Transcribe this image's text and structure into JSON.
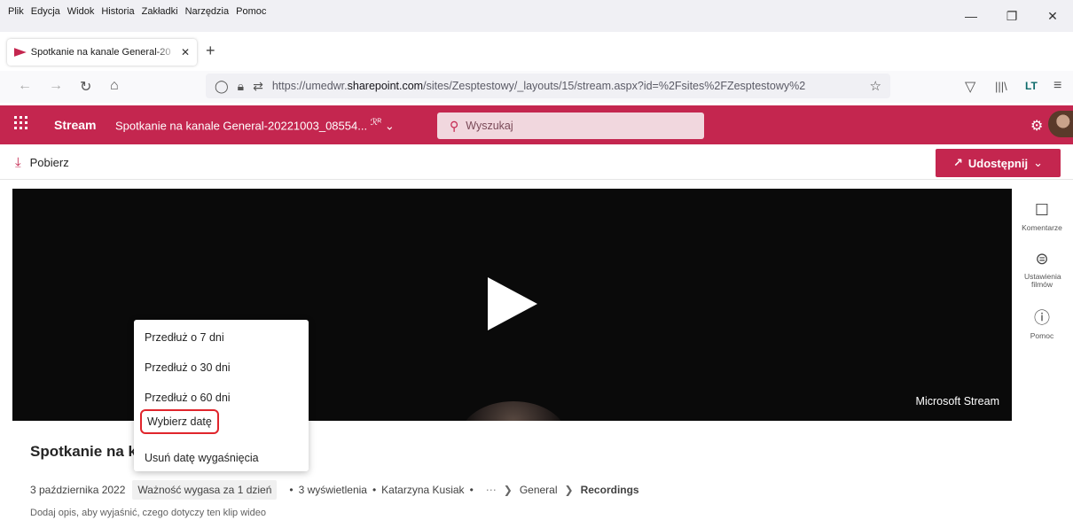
{
  "browser": {
    "menu": [
      "Plik",
      "Edycja",
      "Widok",
      "Historia",
      "Zakładki",
      "Narzędzia",
      "Pomoc"
    ],
    "tab_title": "Spotkanie na kanale General-20",
    "url_prefix": "https://umedwr.",
    "url_domain": "sharepoint.com",
    "url_rest": "/sites/Zesptestowy/_layouts/15/stream.aspx?id=%2Fsites%2FZesptestowy%2"
  },
  "app": {
    "name": "Stream",
    "video_title": "Spotkanie na kanale General-20221003_08554...",
    "search_placeholder": "Wyszukaj",
    "accent": "#c4264f"
  },
  "toolbar": {
    "download_label": "Pobierz",
    "share_label": "Udostępnij"
  },
  "player": {
    "brand": "Microsoft Stream"
  },
  "rail": {
    "comments": "Komentarze",
    "settings": "Ustawienia filmów",
    "help": "Pomoc"
  },
  "video": {
    "heading": "Spotkanie na k",
    "date": "3 października 2022",
    "expiry": "Ważność wygasa za 1 dzień",
    "views": "3 wyświetlenia",
    "author": "Katarzyna Kusiak",
    "crumb_general": "General",
    "crumb_recordings": "Recordings",
    "description_placeholder": "Dodaj opis, aby wyjaśnić, czego dotyczy ten klip wideo"
  },
  "dropdown": {
    "items": [
      "Przedłuż o 7 dni",
      "Przedłuż o 30 dni",
      "Przedłuż o 60 dni",
      "Wybierz datę",
      "Usuń datę wygaśnięcia"
    ]
  },
  "icons": [
    "waffle-icon",
    "search-icon",
    "gear-icon",
    "download-icon",
    "share-icon",
    "comment-icon",
    "settings-toggle-icon",
    "help-icon",
    "play-icon"
  ]
}
